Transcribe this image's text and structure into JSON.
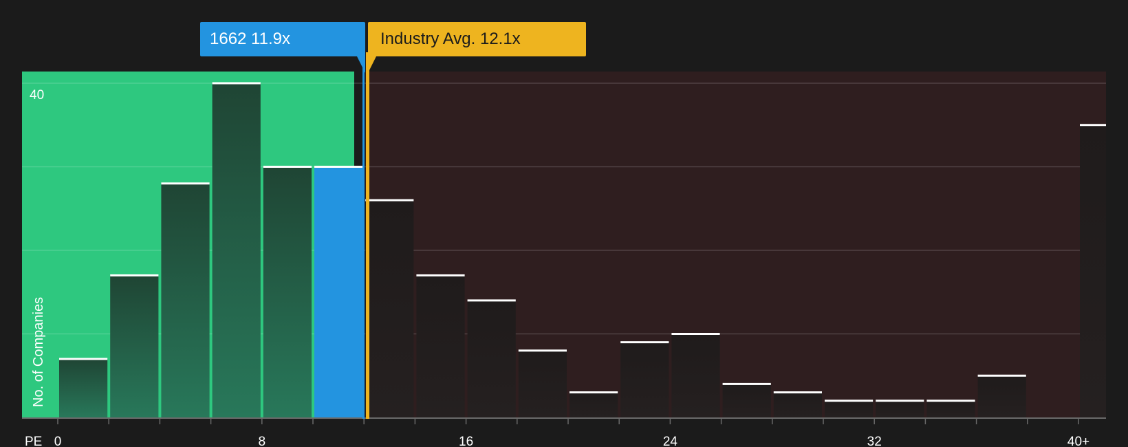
{
  "chart_data": {
    "type": "bar",
    "xlabel": "PE",
    "ylabel": "No. of Companies",
    "x_ticks": [
      "0",
      "8",
      "16",
      "24",
      "32",
      "40+"
    ],
    "y_ticks": [
      "40"
    ],
    "ylim": [
      0,
      40
    ],
    "bin_edges": [
      0,
      2,
      4,
      6,
      8,
      10,
      12,
      14,
      16,
      18,
      20,
      22,
      24,
      26,
      28,
      30,
      32,
      34,
      36,
      38,
      40
    ],
    "values": [
      7,
      17,
      28,
      40,
      30,
      30,
      26,
      17,
      14,
      8,
      3,
      9,
      10,
      4,
      3,
      2,
      2,
      2,
      5,
      35
    ],
    "bin_labels": [
      "0-2",
      "2-4",
      "4-6",
      "6-8",
      "8-10",
      "10-12",
      "12-14",
      "14-16",
      "16-18",
      "18-20",
      "20-22",
      "22-24",
      "24-26",
      "26-28",
      "28-30",
      "30-32",
      "32-34",
      "34-36",
      "36-38",
      "40+"
    ],
    "highlight_bin": "10-12",
    "company": {
      "ticker": "1662",
      "pe": 11.9,
      "label": "1662 11.9x"
    },
    "industry": {
      "avg_pe": 12.1,
      "label": "Industry Avg. 12.1x"
    },
    "colors": {
      "background": "#1b1b1b",
      "undervalued_zone": "#2ec87f",
      "overvalued_zone": "#2f1e1f",
      "company_bar": "#2394e0",
      "industry_line": "#eeb41f",
      "bar_cap": "#ffffff"
    }
  }
}
